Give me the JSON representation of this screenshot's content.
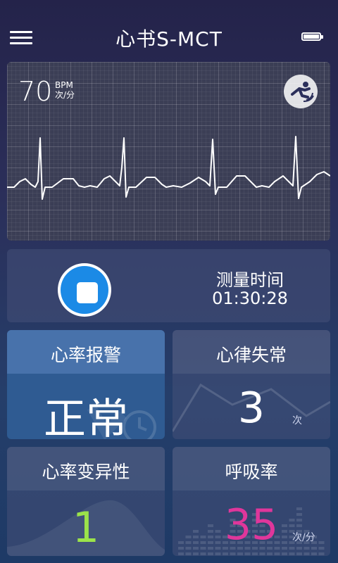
{
  "header": {
    "title": "心书S-MCT"
  },
  "ecg": {
    "heart_rate_value": "70",
    "heart_rate_unit_en": "BPM",
    "heart_rate_unit_cn": "次/分"
  },
  "measure": {
    "label": "测量时间",
    "time": "01:30:28"
  },
  "cards": {
    "hr_alarm": {
      "title": "心率报警",
      "value": "正常"
    },
    "arrhythmia": {
      "title": "心律失常",
      "value": "3",
      "unit": "次"
    },
    "hrv": {
      "title": "心率变异性",
      "value": "1"
    },
    "respiration": {
      "title": "呼吸率",
      "value": "35",
      "unit": "次/分"
    }
  },
  "colors": {
    "stop_button": "#1b8ae6",
    "hrv_value": "#9be34a",
    "respiration_value": "#e0369b"
  }
}
